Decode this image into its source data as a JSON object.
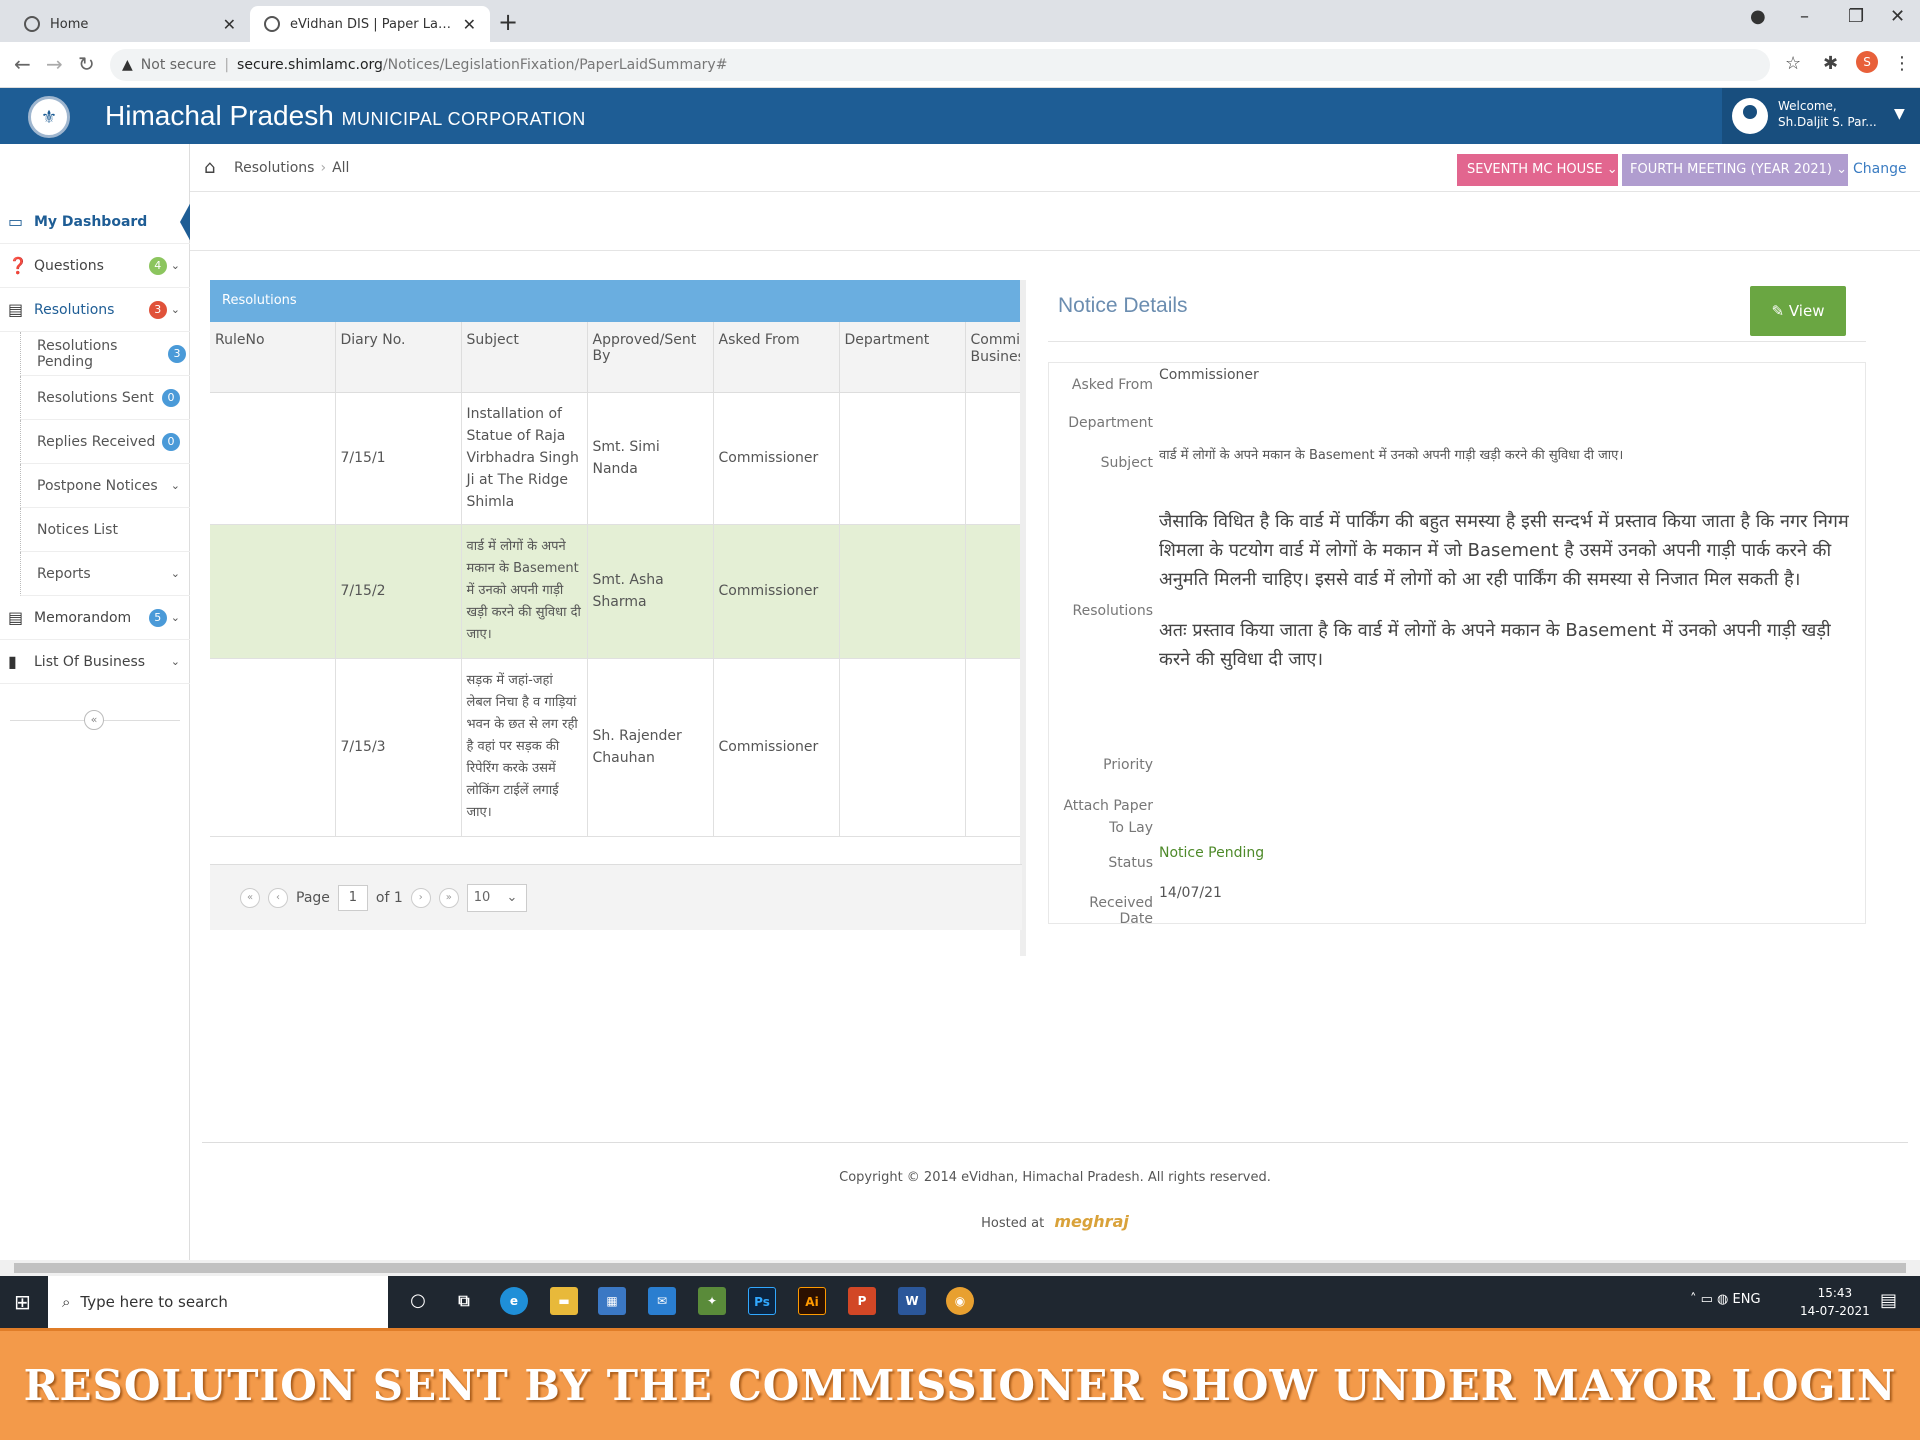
{
  "browser": {
    "tabs": [
      {
        "title": "Home",
        "active": false
      },
      {
        "title": "eVidhan DIS | Paper Laid Summa",
        "active": true
      }
    ],
    "not_secure": "Not secure",
    "url_host": "secure.shimlamc.org",
    "url_path": "/Notices/LegislationFixation/PaperLaidSummary#",
    "profile_initial": "S"
  },
  "header": {
    "title_main": "Himachal Pradesh",
    "title_sub": "MUNICIPAL CORPORATION",
    "welcome": "Welcome,",
    "user_name": "Sh.Daljit S. Par..."
  },
  "breadcrumb": {
    "section": "Resolutions",
    "current": "All",
    "house": "SEVENTH MC HOUSE",
    "meeting": "FOURTH MEETING (YEAR 2021)",
    "change": "Change"
  },
  "sidebar": {
    "dashboard": "My Dashboard",
    "questions": {
      "label": "Questions",
      "count": "4"
    },
    "resolutions": {
      "label": "Resolutions",
      "count": "3"
    },
    "resolutions_pending": {
      "label": "Resolutions Pending",
      "count": "3"
    },
    "resolutions_sent": {
      "label": "Resolutions Sent",
      "count": "0"
    },
    "replies_received": {
      "label": "Replies Received",
      "count": "0"
    },
    "postpone_notices": "Postpone Notices",
    "notices_list": "Notices List",
    "reports": "Reports",
    "memorandom": {
      "label": "Memorandom",
      "count": "5"
    },
    "list_of_business": "List Of Business",
    "colors": {
      "green": "#8cc55e",
      "red": "#e0523a",
      "blue": "#4a9ad8"
    }
  },
  "grid": {
    "title": "Resolutions",
    "columns": [
      "RuleNo",
      "Diary No.",
      "Subject",
      "Approved/Sent By",
      "Asked From",
      "Department",
      "Commit Busines"
    ],
    "rows": [
      {
        "rule": "",
        "diary": "7/15/1",
        "subject": "Installation of Statue of Raja Virbhadra Singh Ji at The Ridge Shimla",
        "approved": "Smt. Simi Nanda",
        "asked": "Commissioner",
        "dept": "",
        "commit": ""
      },
      {
        "rule": "",
        "diary": "7/15/2",
        "subject": "वार्ड में लोगों के अपने मकान के Basement में उनको अपनी गाड़ी खड़ी करने की सुविधा दी जाए।",
        "approved": "Smt. Asha Sharma",
        "asked": "Commissioner",
        "dept": "",
        "commit": ""
      },
      {
        "rule": "",
        "diary": "7/15/3",
        "subject": "सड़क में जहां-जहां लेबल निचा है व गाड़ियां भवन के छत से लग रही है वहां पर सड़क की रिपेरिंग करके उसमें लोकिंग टाईलें लगाई जाए।",
        "approved": "Sh. Rajender Chauhan",
        "asked": "Commissioner",
        "dept": "",
        "commit": ""
      }
    ],
    "pager": {
      "page_label": "Page",
      "page": "1",
      "of_label": "of 1",
      "size": "10"
    }
  },
  "details": {
    "title": "Notice Details",
    "view_button": "View",
    "labels": {
      "asked_from": "Asked From",
      "department": "Department",
      "subject": "Subject",
      "resolutions": "Resolutions",
      "priority": "Priority",
      "attach": "Attach Paper To Lay",
      "status": "Status",
      "received": "Received Date"
    },
    "asked_from": "Commissioner",
    "subject": "वार्ड में लोगों के अपने मकान के Basement में उनको अपनी गाड़ी खड़ी करने की सुविधा दी जाए।",
    "resolution_p1": "जैसाकि विधित है कि वार्ड में पार्किंग की बहुत समस्या है इसी सन्दर्भ में प्रस्ताव किया जाता है कि नगर निगम शिमला के पटयोग वार्ड में लोगों के मकान में जो Basement है उसमें उनको अपनी गाड़ी पार्क करने की अनुमति मिलनी चाहिए। इससे वार्ड में लोगों को आ रही पार्किंग की समस्या से निजात मिल सकती है।",
    "resolution_p2": "अतः प्रस्ताव किया जाता है कि वार्ड में लोगों के अपने मकान के Basement में उनको अपनी गाड़ी खड़ी करने की सुविधा दी जाए।",
    "status": "Notice Pending",
    "received_date": "14/07/21"
  },
  "footer": {
    "copyright": "Copyright © 2014 eVidhan, Himachal Pradesh. All rights reserved.",
    "hosted": "Hosted at",
    "host_logo": "meghraj"
  },
  "taskbar": {
    "search_placeholder": "Type here to search",
    "lang": "ENG",
    "time": "15:43",
    "date": "14-07-2021"
  },
  "banner": {
    "caption": "RESOLUTION SENT BY THE COMMISSIONER SHOW UNDER MAYOR LOGIN"
  }
}
